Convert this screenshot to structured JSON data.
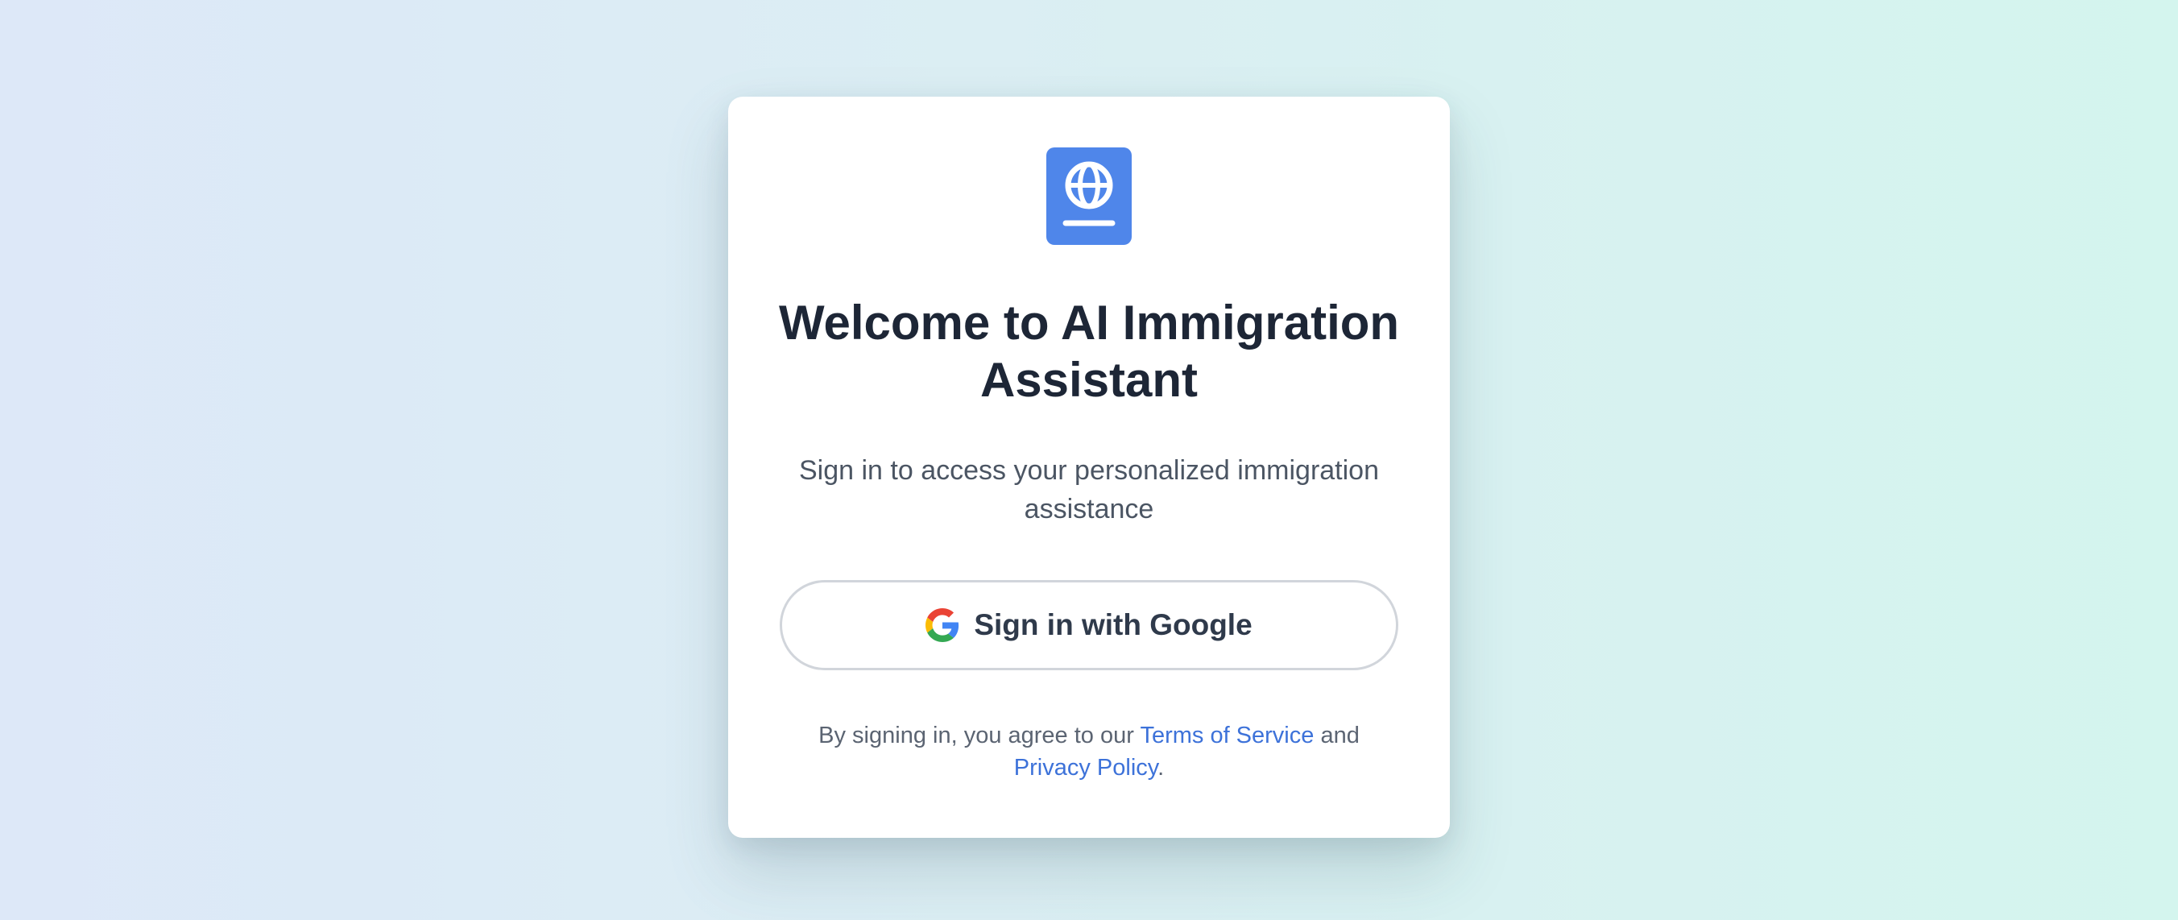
{
  "app": {
    "title_line1": "Welcome to AI Immigration",
    "title_line2": "Assistant",
    "subtitle_line1": "Sign in to access your personalized immigration",
    "subtitle_line2": "assistance",
    "logo_icon": "passport-icon",
    "brand_color": "#4f86ea"
  },
  "auth": {
    "google_button_label": "Sign in with Google",
    "google_icon": "google-icon"
  },
  "legal": {
    "prefix": "By signing in, you agree to our ",
    "terms_label": "Terms of Service",
    "middle": " and",
    "privacy_label": "Privacy Policy",
    "suffix": ".",
    "link_color": "#3d72d9"
  }
}
